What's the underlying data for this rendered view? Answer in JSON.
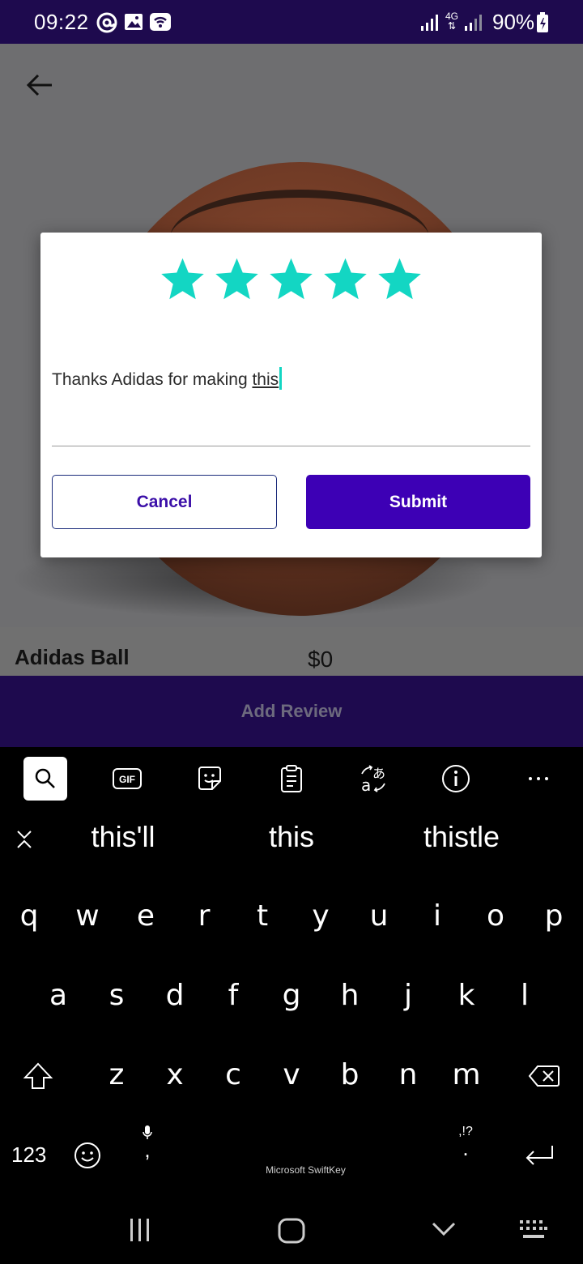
{
  "status_bar": {
    "time": "09:22",
    "battery": "90%",
    "network": "4G"
  },
  "product": {
    "name": "Adidas Ball",
    "price": "$0",
    "add_review_label": "Add Review"
  },
  "dialog": {
    "rating": 5,
    "rating_max": 5,
    "star_color": "#13D6C3",
    "review_text_prefix": "Thanks Adidas for making ",
    "review_text_current_word": "this",
    "cancel_label": "Cancel",
    "submit_label": "Submit"
  },
  "keyboard": {
    "toolbar": [
      "search-icon",
      "gif-icon",
      "sticker-icon",
      "clipboard-icon",
      "translate-icon",
      "info-icon",
      "more-icon"
    ],
    "gif_label": "GIF",
    "suggestions": [
      "this'll",
      "this",
      "thistle"
    ],
    "rows": [
      [
        "q",
        "w",
        "e",
        "r",
        "t",
        "y",
        "u",
        "i",
        "o",
        "p"
      ],
      [
        "a",
        "s",
        "d",
        "f",
        "g",
        "h",
        "j",
        "k",
        "l"
      ],
      [
        "z",
        "x",
        "c",
        "v",
        "b",
        "n",
        "m"
      ]
    ],
    "numbers_key": "123",
    "comma": ",",
    "period": ".",
    "punct_hint": ",!?",
    "brand": "Microsoft SwiftKey"
  },
  "colors": {
    "status_bar": "#1E0A4E",
    "submit_button": "#3D00B5",
    "star": "#13D6C3"
  }
}
